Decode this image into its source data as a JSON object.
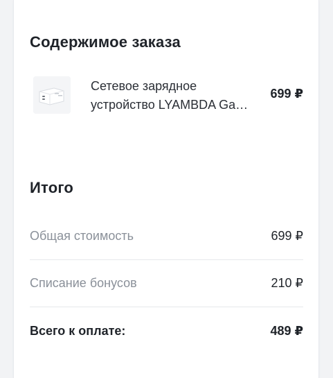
{
  "order_contents": {
    "title": "Содержимое заказа",
    "items": [
      {
        "image_icon": "charger-product-image",
        "name": "Сетевое зарядное устройство LYAMBDA Ga…",
        "price": "699 ₽"
      }
    ]
  },
  "summary": {
    "title": "Итого",
    "rows": [
      {
        "label": "Общая стоимость",
        "value": "699 ₽"
      },
      {
        "label": "Списание бонусов",
        "value": "210 ₽"
      },
      {
        "label": "Всего к оплате:",
        "value": "489 ₽"
      }
    ]
  },
  "colors": {
    "background": "#f2f3f5",
    "card": "#ffffff",
    "text_primary": "#1f2329",
    "text_muted": "#8a9099",
    "divider": "#e6e8eb"
  }
}
